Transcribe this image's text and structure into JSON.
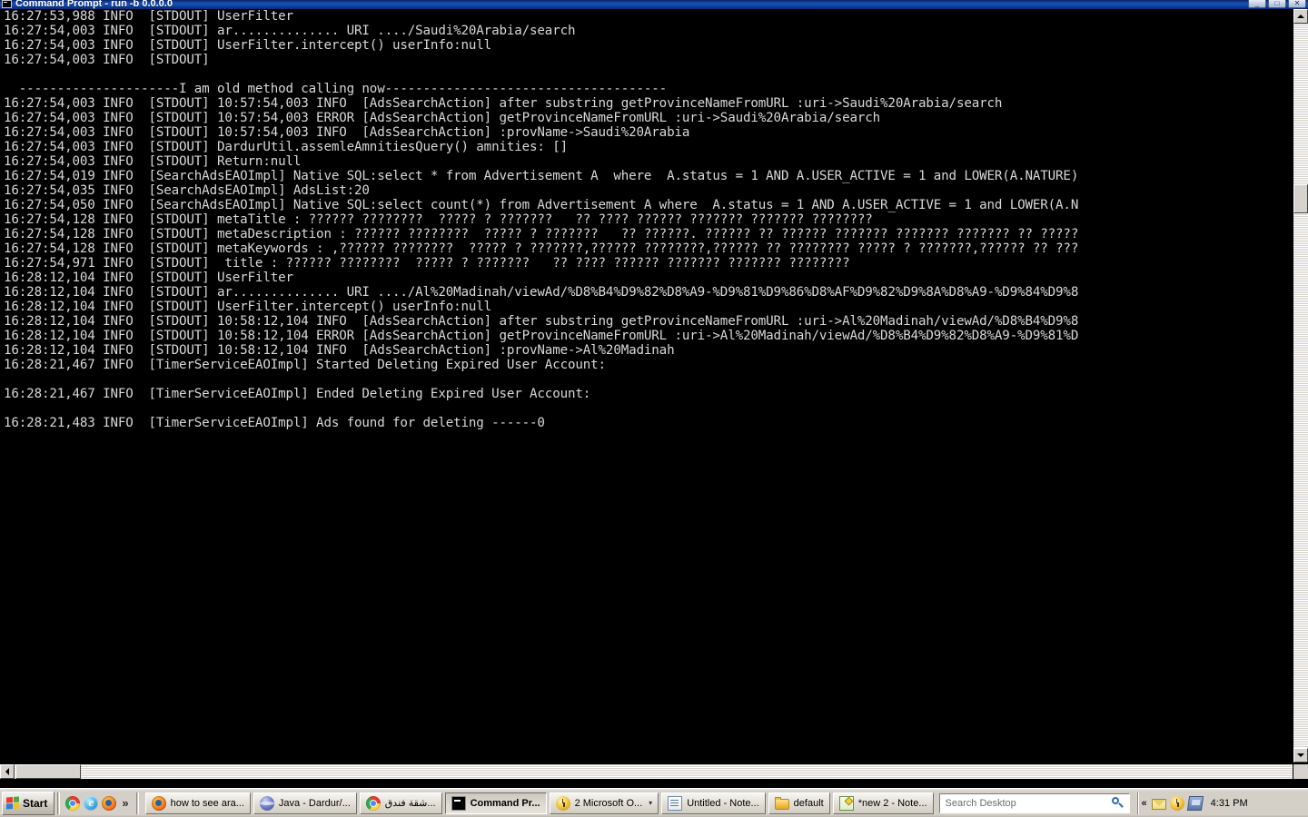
{
  "window": {
    "title": "Command Prompt - run  -b 0.0.0.0",
    "icon": "cmd-icon",
    "minimize_label": "_",
    "maximize_label": "□",
    "close_label": "✕"
  },
  "console": {
    "lines": [
      "16:27:53,988 INFO  [STDOUT] UserFilter",
      "16:27:54,003 INFO  [STDOUT] ar.............. URI ..../Saudi%20Arabia/search",
      "16:27:54,003 INFO  [STDOUT] UserFilter.intercept() userInfo:null",
      "16:27:54,003 INFO  [STDOUT]",
      "",
      "  ---------------------I am old method calling now-------------------------------------",
      "16:27:54,003 INFO  [STDOUT] 10:57:54,003 INFO  [AdsSearchAction] after substring getProvinceNameFromURL :uri->Saudi%20Arabia/search",
      "16:27:54,003 INFO  [STDOUT] 10:57:54,003 ERROR [AdsSearchAction] getProvinceNameFromURL :uri->Saudi%20Arabia/search",
      "16:27:54,003 INFO  [STDOUT] 10:57:54,003 INFO  [AdsSearchAction] :provName->Saudi%20Arabia",
      "16:27:54,003 INFO  [STDOUT] DardurUtil.assemleAmnitiesQuery() amnities: []",
      "16:27:54,003 INFO  [STDOUT] Return:null",
      "16:27:54,019 INFO  [SearchAdsEAOImpl] Native SQL:select * from Advertisement A  where  A.status = 1 AND A.USER_ACTIVE = 1 and LOWER(A.NATURE)",
      "16:27:54,035 INFO  [SearchAdsEAOImpl] AdsList:20",
      "16:27:54,050 INFO  [SearchAdsEAOImpl] Native SQL:select count(*) from Advertisement A where  A.status = 1 AND A.USER_ACTIVE = 1 and LOWER(A.N",
      "16:27:54,128 INFO  [STDOUT] metaTitle : ?????? ????????  ????? ? ???????   ?? ???? ?????? ??????? ??????? ????????",
      "16:27:54,128 INFO  [STDOUT] metaDescription : ?????? ????????  ????? ? ???????   ?? ??????. ?????? ?? ?????? ??????? ??????? ??????? ?? ?????",
      "16:27:54,128 INFO  [STDOUT] metaKeywords : ,?????? ????????  ????? ? ???????,?????? ????????,?????? ?? ???????? ????? ? ???????,?????? ?? ???",
      "16:27:54,971 INFO  [STDOUT]  title : ?????? ????????  ????? ? ???????   ?? ???? ?????? ??????? ??????? ????????",
      "16:28:12,104 INFO  [STDOUT] UserFilter",
      "16:28:12,104 INFO  [STDOUT] ar.............. URI ..../Al%20Madinah/viewAd/%D8%B4%D9%82%D8%A9-%D9%81%D9%86%D8%AF%D9%82%D9%8A%D8%A9-%D9%84%D9%8",
      "16:28:12,104 INFO  [STDOUT] UserFilter.intercept() userInfo:null",
      "16:28:12,104 INFO  [STDOUT] 10:58:12,104 INFO  [AdsSearchAction] after substring getProvinceNameFromURL :uri->Al%20Madinah/viewAd/%D8%B4%D9%8",
      "16:28:12,104 INFO  [STDOUT] 10:58:12,104 ERROR [AdsSearchAction] getProvinceNameFromURL :uri->Al%20Madinah/viewAd/%D8%B4%D9%82%D8%A9-%D9%81%D",
      "16:28:12,104 INFO  [STDOUT] 10:58:12,104 INFO  [AdsSearchAction] :provName->Al%20Madinah",
      "16:28:21,467 INFO  [TimerServiceEAOImpl] Started Deleting Expired User Account:",
      "",
      "16:28:21,467 INFO  [TimerServiceEAOImpl] Ended Deleting Expired User Account:",
      "",
      "16:28:21,483 INFO  [TimerServiceEAOImpl] Ads found for deleting ------0"
    ],
    "text_color": "#d8d8d8",
    "background_color": "#000000"
  },
  "scrollbars": {
    "vertical_up_label": "▲",
    "vertical_down_label": "▼",
    "horizontal_left_label": "◀",
    "horizontal_right_label": "▶"
  },
  "taskbar": {
    "start_label": "Start",
    "quick_launch": [
      {
        "name": "chrome-icon",
        "class": "ico-chrome"
      },
      {
        "name": "internet-explorer-icon",
        "class": "ico-ie"
      },
      {
        "name": "firefox-icon",
        "class": "ico-firefox"
      }
    ],
    "quick_launch_more": "»",
    "tasks": [
      {
        "label": "how to see ara...",
        "icon": "firefox-icon",
        "icon_class": "ico-firefox",
        "active": false,
        "caret": ""
      },
      {
        "label": "Java - Dardur/...",
        "icon": "java-eclipse-icon",
        "icon_class": "ico-java",
        "active": false,
        "caret": ""
      },
      {
        "label": "شقة فندق...",
        "icon": "chrome-icon",
        "icon_class": "ico-chrome",
        "active": false,
        "caret": ""
      },
      {
        "label": "Command Pr...",
        "icon": "cmd-icon",
        "icon_class": "ico-cmd",
        "active": true,
        "caret": ""
      },
      {
        "label": "2 Microsoft O...",
        "icon": "outlook-icon",
        "icon_class": "ico-outlook",
        "active": false,
        "caret": "▾"
      },
      {
        "label": "Untitled - Note...",
        "icon": "notepad-icon",
        "icon_class": "ico-notepad",
        "active": false,
        "caret": ""
      },
      {
        "label": "default",
        "icon": "folder-icon",
        "icon_class": "ico-folder",
        "active": false,
        "caret": ""
      },
      {
        "label": "*new  2 - Note...",
        "icon": "new-document-icon",
        "icon_class": "ico-newdoc",
        "active": false,
        "caret": ""
      }
    ],
    "search": {
      "placeholder": "Search Desktop",
      "value": "",
      "icon": "search-icon"
    },
    "tray": {
      "expand_label": "«",
      "icons": [
        {
          "name": "mail-icon",
          "class": "ico-mail"
        },
        {
          "name": "outlook-icon",
          "class": "ico-tray-outlook"
        },
        {
          "name": "network-icon",
          "class": "ico-network"
        }
      ],
      "clock": "4:31 PM"
    }
  }
}
